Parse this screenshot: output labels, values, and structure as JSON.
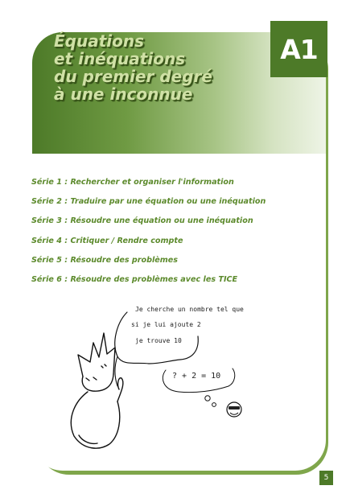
{
  "chapter": {
    "badge": "A1",
    "title_lines": [
      "Équations",
      "et inéquations",
      "du premier degré",
      "à une inconnue"
    ]
  },
  "series": [
    "Série 1 : Rechercher et organiser l'information",
    "Série 2 : Traduire par une équation ou une inéquation",
    "Série 3 : Résoudre une équation ou une inéquation",
    "Série 4 : Critiquer / Rendre compte",
    "Série 5 : Résoudre des problèmes",
    "Série 6 : Résoudre des problèmes avec les TICE"
  ],
  "speech_bubble": {
    "lines": [
      "Je cherche un nombre tel que",
      "si je lui ajoute 2",
      "je trouve 10"
    ]
  },
  "thought_bubble": {
    "equation": "? + 2 = 10"
  },
  "footer": {
    "page_number": "5"
  },
  "colors": {
    "accent_dark": "#4d7a28",
    "series_text": "#5c8a2c",
    "title_text": "#d0e1a6"
  }
}
